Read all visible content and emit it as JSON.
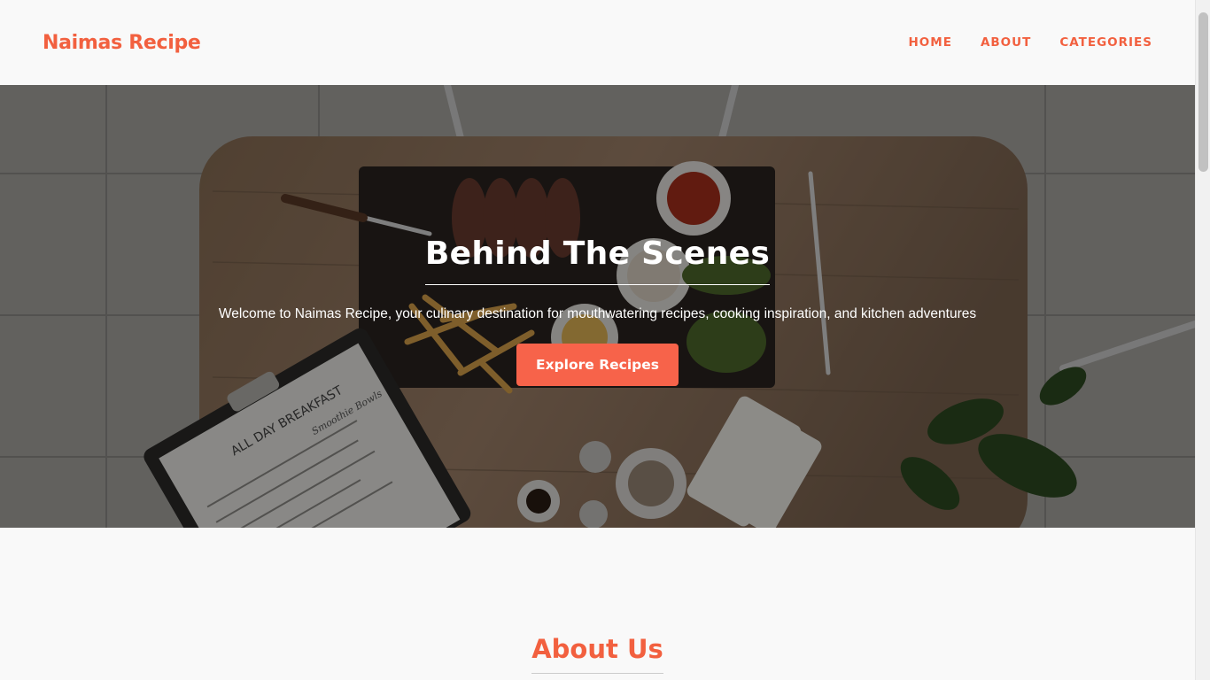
{
  "brand": {
    "name": "Naimas Recipe"
  },
  "nav": {
    "items": [
      {
        "label": "HOME"
      },
      {
        "label": "ABOUT"
      },
      {
        "label": "CATEGORIES"
      }
    ]
  },
  "hero": {
    "title": "Behind The Scenes",
    "subtitle": "Welcome to Naimas Recipe, your culinary destination for mouthwatering recipes, cooking inspiration, and kitchen adventures",
    "cta_label": "Explore Recipes",
    "menu_card_text": "ALL DAY BREAKFAST",
    "menu_card_script": "Smoothie Bowls"
  },
  "about": {
    "title": "About Us"
  },
  "colors": {
    "accent": "#f2603f",
    "button": "#f7634a",
    "background": "#f9f9f9"
  }
}
